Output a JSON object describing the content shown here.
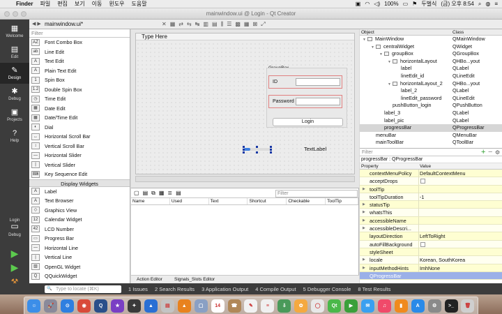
{
  "menubar": {
    "app": "Finder",
    "items": [
      "파일",
      "편집",
      "보기",
      "이동",
      "윈도우",
      "도움말"
    ],
    "battery": "100%",
    "input_source": "두벌식",
    "clock": "(금) 오후 8:54"
  },
  "window": {
    "title": "mainwindow.ui @ Login - Qt Creator"
  },
  "modes": [
    {
      "label": "Welcome",
      "icon": "welcome-icon"
    },
    {
      "label": "Edit",
      "icon": "edit-icon"
    },
    {
      "label": "Design",
      "icon": "design-icon"
    },
    {
      "label": "Debug",
      "icon": "debug-icon"
    },
    {
      "label": "Projects",
      "icon": "projects-icon"
    },
    {
      "label": "Help",
      "icon": "help-icon"
    }
  ],
  "kit": {
    "label": "Login",
    "sub": "Debug"
  },
  "doc_tab": "mainwindow.ui*",
  "widget_box": {
    "filter_placeholder": "Filter",
    "items_top": [
      {
        "label": "Font Combo Box",
        "icon": "AZ"
      },
      {
        "label": "Line Edit",
        "icon": "ab"
      },
      {
        "label": "Text Edit",
        "icon": "A"
      },
      {
        "label": "Plain Text Edit",
        "icon": "A"
      },
      {
        "label": "Spin Box",
        "icon": "1"
      },
      {
        "label": "Double Spin Box",
        "icon": "1.2"
      },
      {
        "label": "Time Edit",
        "icon": "◷"
      },
      {
        "label": "Date Edit",
        "icon": "▦"
      },
      {
        "label": "Date/Time Edit",
        "icon": "▦"
      },
      {
        "label": "Dial",
        "icon": "◐"
      },
      {
        "label": "Horizontal Scroll Bar",
        "icon": "↔"
      },
      {
        "label": "Vertical Scroll Bar",
        "icon": "↕"
      },
      {
        "label": "Horizontal Slider",
        "icon": "—"
      },
      {
        "label": "Vertical Slider",
        "icon": "|"
      },
      {
        "label": "Key Sequence Edit",
        "icon": "⌨"
      }
    ],
    "category": "Display Widgets",
    "items_bottom": [
      {
        "label": "Label",
        "icon": "A"
      },
      {
        "label": "Text Browser",
        "icon": "A"
      },
      {
        "label": "Graphics View",
        "icon": "◇"
      },
      {
        "label": "Calendar Widget",
        "icon": "12"
      },
      {
        "label": "LCD Number",
        "icon": "42"
      },
      {
        "label": "Progress Bar",
        "icon": "▭"
      },
      {
        "label": "Horizontal Line",
        "icon": "—"
      },
      {
        "label": "Vertical Line",
        "icon": "|"
      },
      {
        "label": "OpenGL Widget",
        "icon": "▧"
      },
      {
        "label": "QQuickWidget",
        "icon": "Q"
      }
    ]
  },
  "form": {
    "menu_placeholder": "Type Here",
    "groupbox_title": "GroupBox",
    "id_label": "ID",
    "password_label": "Password",
    "login_button": "Login",
    "text_label": "TextLabel",
    "progress_fraction": 0.24
  },
  "action_editor": {
    "filter_placeholder": "Filter",
    "columns": [
      "Name",
      "Used",
      "Text",
      "Shortcut",
      "Checkable",
      "ToolTip"
    ],
    "tabs": [
      "Action Editor",
      "Signals_Slots Editor"
    ]
  },
  "object_inspector": {
    "columns": [
      "Object",
      "Class"
    ],
    "rows": [
      {
        "name": "MainWindow",
        "cls": "QMainWindow",
        "depth": 0,
        "expander": "▼",
        "icon": true
      },
      {
        "name": "centralWidget",
        "cls": "QWidget",
        "depth": 1,
        "expander": "▼",
        "icon": true
      },
      {
        "name": "groupBox",
        "cls": "QGroupBox",
        "depth": 2,
        "expander": "▼",
        "icon": true
      },
      {
        "name": "horizontalLayout",
        "cls": "QHBo...yout",
        "depth": 3,
        "expander": "▼",
        "icon": true
      },
      {
        "name": "label",
        "cls": "QLabel",
        "depth": 4,
        "expander": "",
        "icon": false
      },
      {
        "name": "lineEdit_id",
        "cls": "QLineEdit",
        "depth": 4,
        "expander": "",
        "icon": false
      },
      {
        "name": "horizontalLayout_2",
        "cls": "QHBo...yout",
        "depth": 3,
        "expander": "▼",
        "icon": true
      },
      {
        "name": "label_2",
        "cls": "QLabel",
        "depth": 4,
        "expander": "",
        "icon": false
      },
      {
        "name": "lineEdit_password",
        "cls": "QLineEdit",
        "depth": 4,
        "expander": "",
        "icon": false
      },
      {
        "name": "pushButton_login",
        "cls": "QPushButton",
        "depth": 3,
        "expander": "",
        "icon": false
      },
      {
        "name": "label_3",
        "cls": "QLabel",
        "depth": 2,
        "expander": "",
        "icon": false
      },
      {
        "name": "label_pic",
        "cls": "QLabel",
        "depth": 2,
        "expander": "",
        "icon": false
      },
      {
        "name": "progressBar",
        "cls": "QProgressBar",
        "depth": 2,
        "expander": "",
        "icon": false,
        "selected": true
      },
      {
        "name": "menuBar",
        "cls": "QMenuBar",
        "depth": 1,
        "expander": "",
        "icon": false
      },
      {
        "name": "mainToolBar",
        "cls": "QToolBar",
        "depth": 1,
        "expander": "",
        "icon": false
      },
      {
        "name": "statusBar",
        "cls": "QStatusBar",
        "depth": 1,
        "expander": "",
        "icon": false
      }
    ]
  },
  "property_editor": {
    "filter_placeholder": "Filter",
    "object_line": "progressBar : QProgressBar",
    "columns": [
      "Property",
      "Value"
    ],
    "rows": [
      {
        "name": "contextMenuPolicy",
        "value": "DefaultContextMenu",
        "expand": false,
        "check": false,
        "style": "yellow"
      },
      {
        "name": "acceptDrops",
        "value": "",
        "expand": false,
        "check": true,
        "style": "plain"
      },
      {
        "name": "toolTip",
        "value": "",
        "expand": true,
        "check": false,
        "style": "yellow"
      },
      {
        "name": "toolTipDuration",
        "value": "-1",
        "expand": false,
        "check": false,
        "style": "plain"
      },
      {
        "name": "statusTip",
        "value": "",
        "expand": true,
        "check": false,
        "style": "yellow"
      },
      {
        "name": "whatsThis",
        "value": "",
        "expand": true,
        "check": false,
        "style": "plain"
      },
      {
        "name": "accessibleName",
        "value": "",
        "expand": true,
        "check": false,
        "style": "yellow"
      },
      {
        "name": "accessibleDescri...",
        "value": "",
        "expand": true,
        "check": false,
        "style": "plain"
      },
      {
        "name": "layoutDirection",
        "value": "LeftToRight",
        "expand": false,
        "check": false,
        "style": "yellow"
      },
      {
        "name": "autoFillBackground",
        "value": "",
        "expand": false,
        "check": true,
        "style": "plain"
      },
      {
        "name": "styleSheet",
        "value": "",
        "expand": false,
        "check": false,
        "style": "yellow"
      },
      {
        "name": "locale",
        "value": "Korean, SouthKorea",
        "expand": true,
        "check": false,
        "style": "plain"
      },
      {
        "name": "inputMethodHints",
        "value": "ImhNone",
        "expand": true,
        "check": false,
        "style": "yellow"
      },
      {
        "name": "QProgressBar",
        "value": "",
        "expand": false,
        "check": false,
        "style": "section"
      }
    ]
  },
  "bottom_bar": {
    "locate_placeholder": "Type to locate (⌘K)",
    "tabs": [
      "1 Issues",
      "2 Search Results",
      "3 Application Output",
      "4 Compile Output",
      "5 Debugger Console",
      "8 Test Results"
    ]
  },
  "dock": {
    "apps": [
      {
        "name": "finder",
        "color": "#3c8ee8",
        "glyph": "☺"
      },
      {
        "name": "launchpad",
        "color": "#8a8a9a",
        "glyph": "🚀"
      },
      {
        "name": "safari",
        "color": "#2f7fe0",
        "glyph": "⊙"
      },
      {
        "name": "chrome",
        "color": "#d94b3a",
        "glyph": "◉"
      },
      {
        "name": "quicktime",
        "color": "#2a4f8a",
        "glyph": "Q"
      },
      {
        "name": "imovie",
        "color": "#7a3fc4",
        "glyph": "★"
      },
      {
        "name": "final-cut",
        "color": "#3a3a3a",
        "glyph": "✦"
      },
      {
        "name": "keynote",
        "color": "#2a6fd4",
        "glyph": "▲"
      },
      {
        "name": "preview",
        "color": "#c4c4c4",
        "glyph": "▤"
      },
      {
        "name": "vlc",
        "color": "#e8821e",
        "glyph": "▲"
      },
      {
        "name": "photos-a",
        "color": "#8aa0c4",
        "glyph": "▢"
      },
      {
        "name": "calendar",
        "color": "#ffffff",
        "glyph": "14"
      },
      {
        "name": "contacts",
        "color": "#b08858",
        "glyph": "☎"
      },
      {
        "name": "notes",
        "color": "#f2f2f2",
        "glyph": "✎"
      },
      {
        "name": "reminders",
        "color": "#f0f0f0",
        "glyph": "≡"
      },
      {
        "name": "downloads",
        "color": "#4a9a5a",
        "glyph": "⇩"
      },
      {
        "name": "photos",
        "color": "#f4a940",
        "glyph": "✿"
      },
      {
        "name": "messages-b",
        "color": "#e8e8e8",
        "glyph": "◯"
      },
      {
        "name": "kakao",
        "color": "#4ab84a",
        "glyph": "Qt"
      },
      {
        "name": "facetime",
        "color": "#3aa03a",
        "glyph": "▶"
      },
      {
        "name": "messages",
        "color": "#3aa0f0",
        "glyph": "✉"
      },
      {
        "name": "music",
        "color": "#f04a6a",
        "glyph": "♫"
      },
      {
        "name": "books",
        "color": "#f08a1e",
        "glyph": "▮"
      },
      {
        "name": "app-store",
        "color": "#2a8ae8",
        "glyph": "A"
      },
      {
        "name": "system-preferences",
        "color": "#8a8a8a",
        "glyph": "⚙"
      },
      {
        "name": "terminal",
        "color": "#222222",
        "glyph": ">_"
      },
      {
        "name": "trash",
        "color": "#cfcfcf",
        "glyph": "🗑"
      }
    ]
  }
}
